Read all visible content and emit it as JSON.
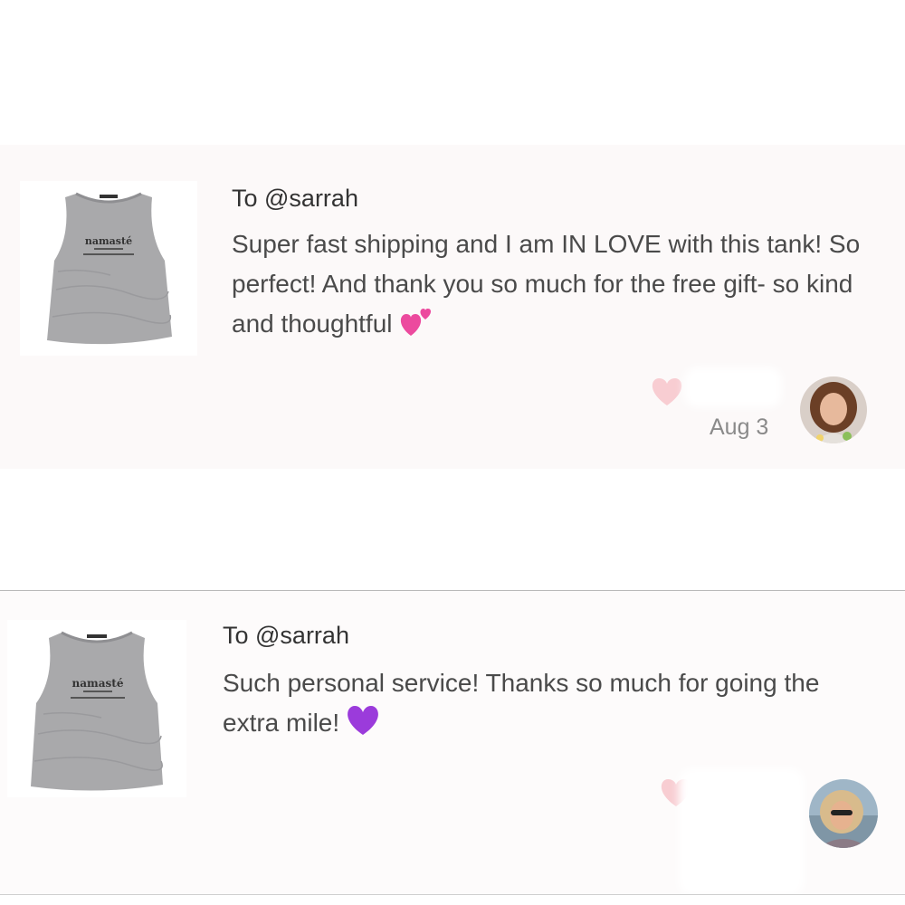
{
  "reviews": [
    {
      "recipient": "To @sarrah",
      "text": "Super fast shipping and I am IN LOVE with this tank! So perfect! And thank you so much for the free gift- so kind and thoughtful",
      "emoji_icon": "two-hearts-icon",
      "date": "Aug 3",
      "product_print": "namasté"
    },
    {
      "recipient": "To @sarrah",
      "text": "Such personal service! Thanks so much for going the extra mile!",
      "emoji_icon": "purple-heart-icon",
      "date": "",
      "product_print": "namasté"
    }
  ],
  "colors": {
    "like_heart": "#f8cdd2",
    "card_bg": "#fcf9f9",
    "tank": "#a9a9ab"
  }
}
